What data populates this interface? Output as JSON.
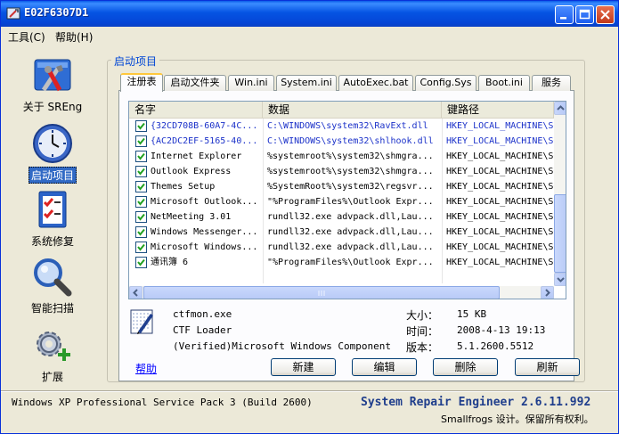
{
  "window": {
    "title": "E02F6307D1"
  },
  "menu": [
    "工具(C)",
    "帮助(H)"
  ],
  "nav": [
    {
      "label": "关于 SREng",
      "icon": "tools-icon"
    },
    {
      "label": "启动项目",
      "icon": "clock-icon"
    },
    {
      "label": "系统修复",
      "icon": "checklist-icon"
    },
    {
      "label": "智能扫描",
      "icon": "magnifier-icon"
    },
    {
      "label": "扩展",
      "icon": "gear-plus-icon"
    }
  ],
  "group_title": "启动项目",
  "tabs": [
    "注册表",
    "启动文件夹",
    "Win.ini",
    "System.ini",
    "AutoExec.bat",
    "Config.Sys",
    "Boot.ini",
    "服务"
  ],
  "list": {
    "columns": [
      "名字",
      "数据",
      "键路径"
    ],
    "rows": [
      {
        "name": "{32CD708B-60A7-4C...",
        "data": "C:\\WINDOWS\\system32\\RavExt.dll",
        "path": "HKEY_LOCAL_MACHINE\\SOF",
        "checked": true,
        "highlight": true
      },
      {
        "name": "{AC2DC2EF-5165-40...",
        "data": "C:\\WINDOWS\\system32\\shlhook.dll",
        "path": "HKEY_LOCAL_MACHINE\\SOF",
        "checked": true,
        "highlight": true
      },
      {
        "name": "Internet Explorer",
        "data": "%systemroot%\\system32\\shmgra...",
        "path": "HKEY_LOCAL_MACHINE\\SOF",
        "checked": true,
        "highlight": false
      },
      {
        "name": "Outlook Express",
        "data": "%systemroot%\\system32\\shmgra...",
        "path": "HKEY_LOCAL_MACHINE\\SOF",
        "checked": true,
        "highlight": false
      },
      {
        "name": "Themes Setup",
        "data": "%SystemRoot%\\system32\\regsvr...",
        "path": "HKEY_LOCAL_MACHINE\\SOF",
        "checked": true,
        "highlight": false
      },
      {
        "name": "Microsoft Outlook...",
        "data": "\"%ProgramFiles%\\Outlook Expr...",
        "path": "HKEY_LOCAL_MACHINE\\SOF",
        "checked": true,
        "highlight": false
      },
      {
        "name": "NetMeeting 3.01",
        "data": "rundll32.exe advpack.dll,Lau...",
        "path": "HKEY_LOCAL_MACHINE\\SOF",
        "checked": true,
        "highlight": false
      },
      {
        "name": "Windows Messenger...",
        "data": "rundll32.exe advpack.dll,Lau...",
        "path": "HKEY_LOCAL_MACHINE\\SOF",
        "checked": true,
        "highlight": false
      },
      {
        "name": "Microsoft Windows...",
        "data": "rundll32.exe advpack.dll,Lau...",
        "path": "HKEY_LOCAL_MACHINE\\SOF",
        "checked": true,
        "highlight": false
      },
      {
        "name": "通讯簿 6",
        "data": "\"%ProgramFiles%\\Outlook Expr...",
        "path": "HKEY_LOCAL_MACHINE\\SOF",
        "checked": true,
        "highlight": false
      }
    ]
  },
  "details": {
    "file": "ctfmon.exe",
    "description": "CTF Loader",
    "company": "(Verified)Microsoft Windows Component",
    "size_label": "大小：",
    "size": "15 KB",
    "time_label": "时间：",
    "time": "2008-4-13 19:13",
    "version_label": "版本：",
    "version": "5.1.2600.5512"
  },
  "help_link": "帮助",
  "buttons": {
    "new": "新建",
    "edit": "编辑",
    "delete": "删除",
    "refresh": "刷新"
  },
  "status": {
    "os": "Windows XP Professional Service Pack 3 (Build 2600)",
    "brand": "System Repair Engineer 2.6.11.992",
    "copyright": "Smallfrogs 设计。保留所有权利。"
  },
  "colors": {
    "title_blue": "#0554e3",
    "accent_link": "#0000ff",
    "highlight_text": "#1b31c9",
    "group_title": "#0046d5"
  }
}
